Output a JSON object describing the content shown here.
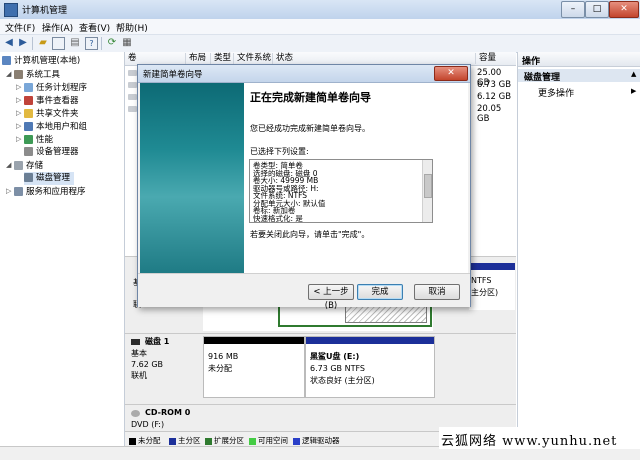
{
  "window": {
    "title": "计算机管理",
    "minimize": "–",
    "maximize": "□",
    "close": "✕"
  },
  "menu": [
    "文件(F)",
    "操作(A)",
    "查看(V)",
    "帮助(H)"
  ],
  "toolbar_icons": [
    "back-arrow-icon",
    "forward-arrow-icon",
    "folder-up-icon",
    "show-tree-icon",
    "properties-icon",
    "help-icon",
    "refresh-icon",
    "export-icon"
  ],
  "tree": {
    "root": "计算机管理(本地)",
    "system_tools": "系统工具",
    "task_scheduler": "任务计划程序",
    "event_viewer": "事件查看器",
    "shared_folders": "共享文件夹",
    "local_users": "本地用户和组",
    "performance": "性能",
    "device_manager": "设备管理器",
    "storage": "存储",
    "disk_management": "磁盘管理",
    "services_apps": "服务和应用程序"
  },
  "columns": {
    "volume": "卷",
    "layout": "布局",
    "type": "类型",
    "filesystem": "文件系统",
    "status": "状态",
    "capacity": "容量"
  },
  "capacities": [
    "25.00 GB",
    "6.73 GB",
    "6.12 GB",
    "20.05 GB"
  ],
  "disks": {
    "disk1": {
      "name": "磁盘 1",
      "type": "基本",
      "size": "7.62 GB",
      "state": "联机",
      "unalloc_size": "916 MB",
      "unalloc_label": "未分配",
      "vol_name": "黑鲨U盘 (E:)",
      "vol_fs": "6.73 GB NTFS",
      "vol_status": "状态良好 (主分区)"
    },
    "cdrom": {
      "name": "CD-ROM 0",
      "drive": "DVD (F:)"
    },
    "disk0_partial": {
      "fs": "NTFS",
      "status": "主分区)",
      "left_label": "基",
      "left_label2": "联"
    }
  },
  "legend": [
    "未分配",
    "主分区",
    "扩展分区",
    "可用空间",
    "逻辑驱动器"
  ],
  "legend_colors": [
    "#000000",
    "#1c2f99",
    "#2f7a2f",
    "#44cc44",
    "#2a3fc8"
  ],
  "actions": {
    "header": "操作",
    "section": "磁盘管理",
    "more": "更多操作"
  },
  "wizard": {
    "title": "新建简单卷向导",
    "heading": "正在完成新建简单卷向导",
    "intro": "您已经成功完成新建简单卷向导。",
    "settings_label": "已选择下列设置:",
    "settings": [
      "卷类型: 简单卷",
      "选择的磁盘: 磁盘 0",
      "卷大小: 49999 MB",
      "驱动器号或路径: H:",
      "文件系统: NTFS",
      "分配单元大小: 默认值",
      "卷标: 新加卷",
      "快速格式化: 是"
    ],
    "close_hint": "若要关闭此向导，请单击\"完成\"。",
    "back": "< 上一步(B)",
    "finish": "完成",
    "cancel": "取消"
  },
  "watermark": "云狐网络 www.yunhu.net"
}
